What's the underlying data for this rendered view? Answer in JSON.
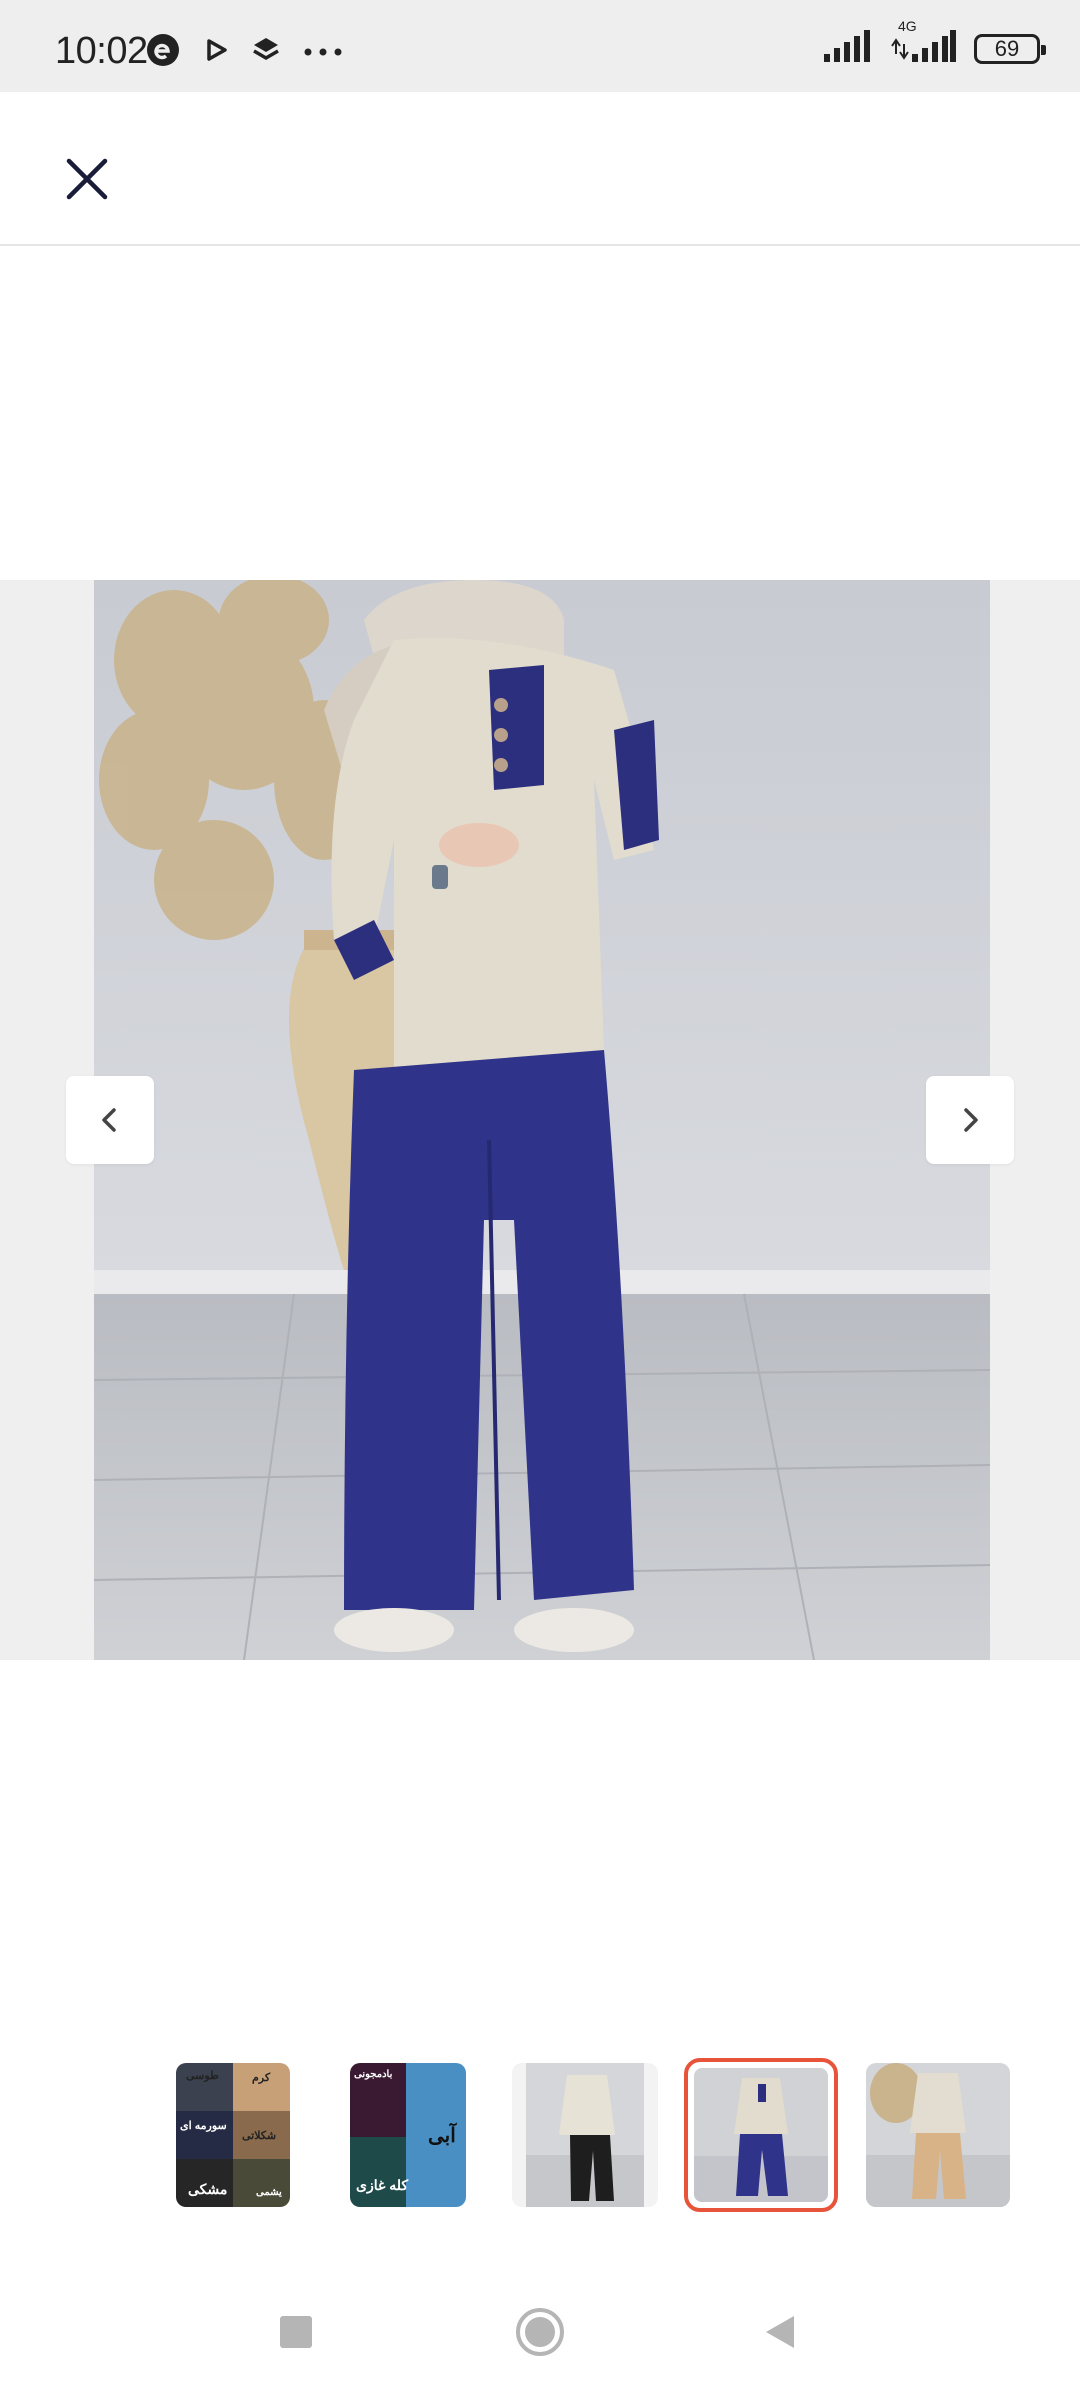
{
  "status_bar": {
    "time": "10:02",
    "network_label": "4G",
    "battery": "69"
  },
  "colors": {
    "active_thumb_border": "#e8543a",
    "top_color": "#e1dccd",
    "trim_color": "#2c2f7e",
    "pants_color": "#30338a"
  },
  "icons": {
    "close": "close-icon",
    "prev": "chevron-left-icon",
    "next": "chevron-right-icon",
    "recents": "square-recents-icon",
    "home": "circle-home-icon",
    "back": "triangle-back-icon"
  },
  "thumbnails": {
    "swatch_set_1": [
      "طوسی",
      "کرم",
      "سورمه ای",
      "شکلاتی",
      "مشکی",
      "یشمی"
    ],
    "swatch_set_2": [
      "بادمجونی",
      "آبی",
      "کله غازی"
    ],
    "active_index": 3
  }
}
